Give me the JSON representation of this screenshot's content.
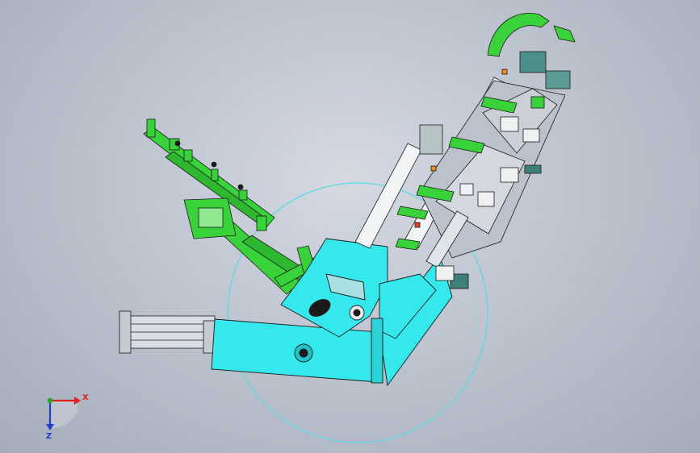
{
  "triad": {
    "x_label": "X",
    "z_label": "Z",
    "x_color": "#e02020",
    "z_color": "#1f3fd0",
    "y_color": "#18b018"
  },
  "colors": {
    "cyan_body": "#35e8ec",
    "green_frame": "#39d23a",
    "dark_outline": "#1a1a1a",
    "grey_fixture": "#bcc2cc",
    "white_rail": "#f2f4f6",
    "rotation_circle": "#5fd9de"
  }
}
